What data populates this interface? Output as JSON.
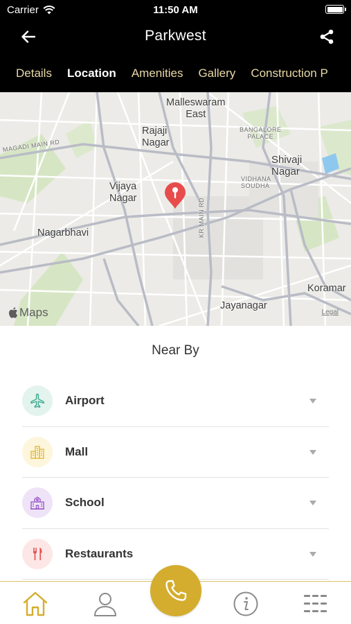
{
  "status_bar": {
    "carrier": "Carrier",
    "time": "11:50 AM"
  },
  "nav": {
    "title": "Parkwest"
  },
  "tabs": [
    {
      "label": "Details",
      "active": false
    },
    {
      "label": "Location",
      "active": true
    },
    {
      "label": "Amenities",
      "active": false
    },
    {
      "label": "Gallery",
      "active": false
    },
    {
      "label": "Construction P",
      "active": false
    }
  ],
  "map": {
    "labels": {
      "malleswaram": "Malleswaram\nEast",
      "rajaji": "Rajaji\nNagar",
      "bangalore_palace": "BANGALORE\nPALACE",
      "shivaji": "Shivaji\nNagar",
      "magadi": "MAGADI MAIN RD",
      "vijaya": "Vijaya\nNagar",
      "vidhana": "VIDHANA\nSOUDHA",
      "nagarbhavi": "Nagarbhavi",
      "kr_main": "KR MAIN RD",
      "koramangala": "Koramar",
      "jayanagar": "Jayanagar"
    },
    "logo": "Maps",
    "legal": "Legal"
  },
  "nearby": {
    "title": "Near By",
    "items": [
      {
        "label": "Airport",
        "icon": "airplane-icon",
        "bg": "#e3f3ee",
        "color": "#3aa88a"
      },
      {
        "label": "Mall",
        "icon": "buildings-icon",
        "bg": "#fdf6dc",
        "color": "#e2b93b"
      },
      {
        "label": "School",
        "icon": "school-icon",
        "bg": "#efe3f8",
        "color": "#9a5cc8"
      },
      {
        "label": "Restaurants",
        "icon": "fork-knife-icon",
        "bg": "#fde6e6",
        "color": "#e05050"
      }
    ]
  },
  "colors": {
    "accent": "#d4ad2e",
    "tab_inactive": "#e8d9a8",
    "pin": "#e84b4b"
  }
}
